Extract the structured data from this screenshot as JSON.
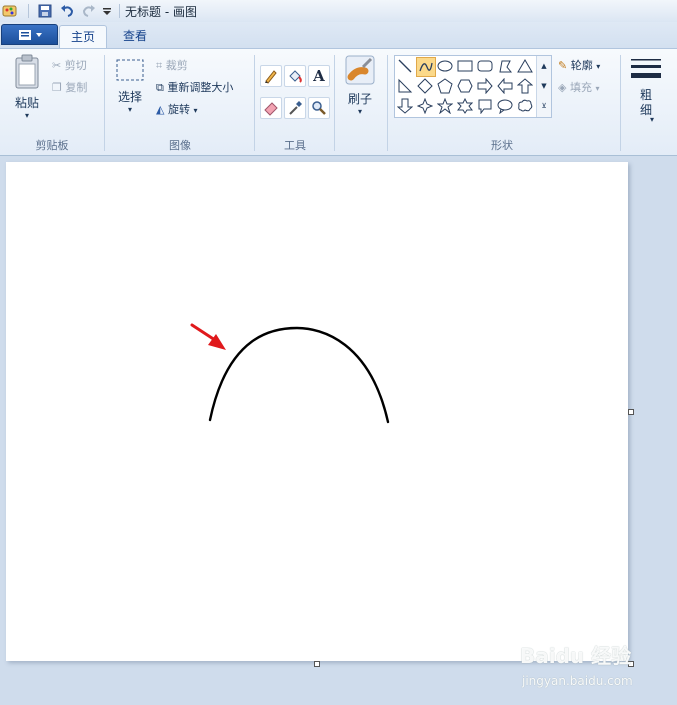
{
  "window": {
    "title": "无标题 - 画图"
  },
  "tabs": {
    "file_icon": "menu-icon",
    "home": "主页",
    "view": "查看"
  },
  "clipboard": {
    "paste": "粘贴",
    "cut": "剪切",
    "copy": "复制",
    "group": "剪贴板"
  },
  "image": {
    "select": "选择",
    "crop": "裁剪",
    "resize": "重新调整大小",
    "rotate": "旋转",
    "group": "图像"
  },
  "tools": {
    "group": "工具",
    "text_glyph": "A"
  },
  "brushes": {
    "label": "刷子"
  },
  "shapes": {
    "outline": "轮廓",
    "fill": "填充",
    "group": "形状"
  },
  "size": {
    "label": "粗\n细"
  },
  "watermark": {
    "brand": "Baidu 经验",
    "url": "jingyan.baidu.com"
  },
  "colors": {
    "accent": "#1c4f9b",
    "arrow": "#e0191c",
    "stroke": "#000000"
  }
}
